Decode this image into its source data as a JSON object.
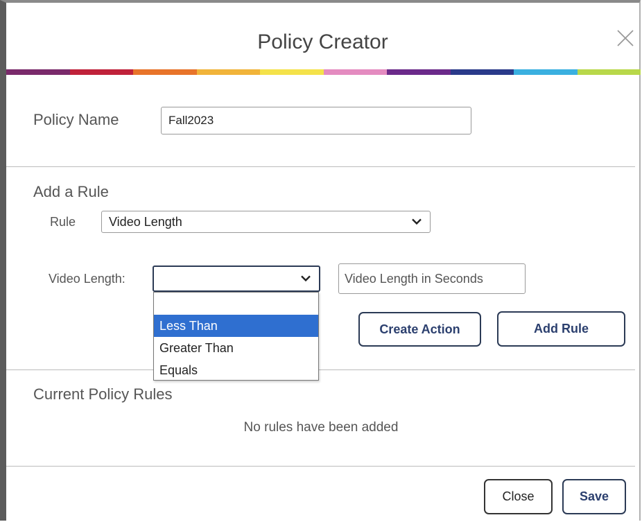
{
  "dialog": {
    "title": "Policy Creator",
    "close_icon": "close-icon"
  },
  "rainbow_colors": [
    "#7a2a6b",
    "#c0223a",
    "#e8742a",
    "#f1b43a",
    "#f4e24a",
    "#e48bc0",
    "#6b2a8a",
    "#2a3a8a",
    "#3ab0e0",
    "#b8d84a"
  ],
  "policy_name": {
    "label": "Policy Name",
    "value": "Fall2023"
  },
  "add_rule": {
    "section_title": "Add a Rule",
    "rule_label": "Rule",
    "rule_selected": "Video Length",
    "video_length_label": "Video Length:",
    "video_length_selected": "",
    "video_length_options": [
      "",
      "Less Than",
      "Greater Than",
      "Equals"
    ],
    "highlighted_option": "Less Than",
    "seconds_placeholder": "Video Length in Seconds",
    "create_action_label": "Create Action",
    "add_rule_label": "Add Rule"
  },
  "current_rules": {
    "section_title": "Current Policy Rules",
    "empty_message": "No rules have been added"
  },
  "footer": {
    "close_label": "Close",
    "save_label": "Save"
  }
}
